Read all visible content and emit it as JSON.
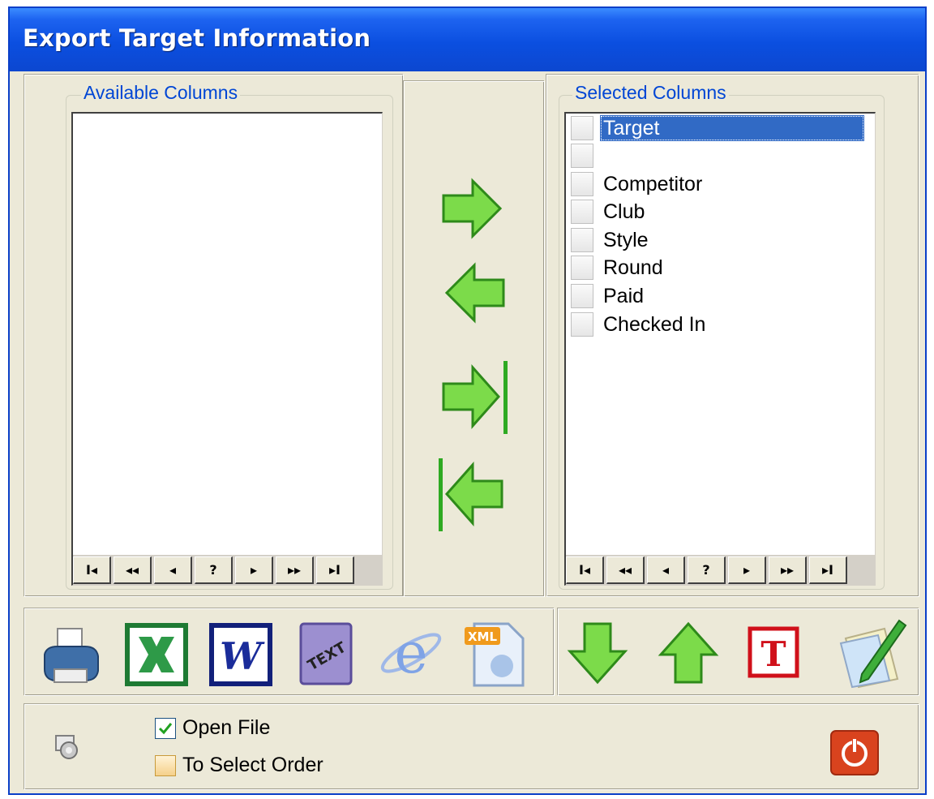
{
  "window": {
    "title": "Export Target Information"
  },
  "available": {
    "legend": "Available Columns",
    "items": []
  },
  "selected": {
    "legend": "Selected Columns",
    "items": [
      "Target",
      "",
      "Competitor",
      "Club",
      "Style",
      "Round",
      "Paid",
      "Checked In"
    ],
    "selected_index": 0
  },
  "navigator": {
    "buttons": [
      "I◂",
      "◂◂",
      "◂",
      "?",
      "▸",
      "▸▸",
      "▸I"
    ]
  },
  "transfer_buttons": [
    "arrow-right-icon",
    "arrow-left-icon",
    "arrow-right-all-icon",
    "arrow-left-all-icon"
  ],
  "export_toolbar": [
    "printer-icon",
    "excel-icon",
    "word-icon",
    "text-icon",
    "ie-icon",
    "xml-icon"
  ],
  "order_toolbar": [
    "move-down-icon",
    "move-up-icon",
    "title-icon",
    "edit-icon"
  ],
  "options": {
    "open_file": {
      "label": "Open File",
      "checked": true
    },
    "select_order": {
      "label": "To Select Order",
      "checked": false
    }
  },
  "colors": {
    "accent": "#316AC5",
    "title_bar": "#0B4FE0",
    "arrow_green": "#7CDB4A",
    "close_red": "#D9431E"
  }
}
